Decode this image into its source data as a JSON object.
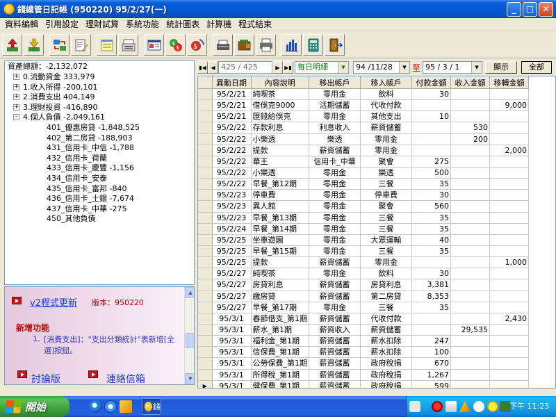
{
  "window": {
    "title": "錢總管日記帳 (950220) 95/2/27(一)",
    "controls": {
      "minimize": "_",
      "maximize": "□",
      "close": "✕"
    }
  },
  "menu": [
    "資料編輯",
    "引用設定",
    "理財試算",
    "系統功能",
    "統計圖表",
    "計算機",
    "程式結束"
  ],
  "toolbar_icons": [
    "import-up-icon",
    "export-down-icon",
    "transfer-icon",
    "edit-note-icon",
    "notepad-icon",
    "register-icon",
    "card-icon",
    "currency-exchange-icon",
    "currency-convert-icon",
    "scanner-icon",
    "wallet-icon",
    "print-icon",
    "bar-chart-icon",
    "calculator-icon",
    "exit-door-icon"
  ],
  "tree": {
    "root": "資產總額：-2,132,072",
    "nodes": [
      {
        "label": "0.流動資金 333,979",
        "expander": "+"
      },
      {
        "label": "1.收入所得 -200,101",
        "expander": "+"
      },
      {
        "label": "2.消費支出 404,149",
        "expander": "+"
      },
      {
        "label": "3.理財投資 -416,890",
        "expander": "+"
      },
      {
        "label": "4.個人負債 -2,049,161",
        "expander": "-"
      }
    ],
    "children": [
      "401_優惠房貸 -1,848,525",
      "402_第二房貸 -188,903",
      "431_信用卡_中信 -1,788",
      "432_信用卡_荷蘭",
      "433_信用卡_慶豐 -1,156",
      "434_信用卡_安泰",
      "435_信用卡_富邦 -840",
      "436_信用卡_土銀 -7,674",
      "437_信用卡_中華 -275",
      "450_其他負債"
    ]
  },
  "news": {
    "update_link": "v2程式更新",
    "version_label": "版本：950220",
    "features_title": "新增功能",
    "item_number": "1.",
    "item_text": "[消費支出]：\"支出分類統計\"表新增[全選]按鈕。",
    "forum_link": "討論版",
    "contact_link": "連絡信箱"
  },
  "nav": {
    "record_position": "425 / 425",
    "view_mode": "每日明細",
    "date_from": "94 /11/28",
    "to_label": "至",
    "date_to": "95 / 3 / 1",
    "show_button": "顯示",
    "all_button": "全部"
  },
  "grid": {
    "columns": [
      "異動日期",
      "內容說明",
      "移出帳戶",
      "移入帳戶",
      "付款金額",
      "收入金額",
      "移轉金額"
    ],
    "current_row_marker": "▶",
    "rows": [
      [
        "95/2/21",
        "純喫茶",
        "零用金",
        "飲料",
        "30",
        "",
        ""
      ],
      [
        "95/2/21",
        "借俁克9000",
        "活期儲蓄",
        "代收付款",
        "",
        "",
        "9,000"
      ],
      [
        "95/2/21",
        "匯錢給俁克",
        "零用金",
        "其他支出",
        "10",
        "",
        ""
      ],
      [
        "95/2/22",
        "存款利息",
        "利息收入",
        "薪資儲蓄",
        "",
        "530",
        ""
      ],
      [
        "95/2/22",
        "小樂透",
        "樂透",
        "零用金",
        "",
        "200",
        ""
      ],
      [
        "95/2/22",
        "提款",
        "薪資儲蓄",
        "零用金",
        "",
        "",
        "2,000"
      ],
      [
        "95/2/22",
        "華王",
        "信用卡_中華",
        "聚會",
        "275",
        "",
        ""
      ],
      [
        "95/2/22",
        "小樂透",
        "零用金",
        "樂透",
        "500",
        "",
        ""
      ],
      [
        "95/2/22",
        "早餐_第12期",
        "零用金",
        "三餐",
        "35",
        "",
        ""
      ],
      [
        "95/2/23",
        "停車費",
        "零用金",
        "停車費",
        "30",
        "",
        ""
      ],
      [
        "95/2/23",
        "異人館",
        "零用金",
        "聚會",
        "560",
        "",
        ""
      ],
      [
        "95/2/23",
        "早餐_第13期",
        "零用金",
        "三餐",
        "35",
        "",
        ""
      ],
      [
        "95/2/24",
        "早餐_第14期",
        "零用金",
        "三餐",
        "35",
        "",
        ""
      ],
      [
        "95/2/25",
        "坐車遊園",
        "零用金",
        "大眾運輸",
        "40",
        "",
        ""
      ],
      [
        "95/2/25",
        "早餐_第15期",
        "零用金",
        "三餐",
        "35",
        "",
        ""
      ],
      [
        "95/2/25",
        "提款",
        "薪資儲蓄",
        "零用金",
        "",
        "",
        "1,000"
      ],
      [
        "95/2/27",
        "純喫茶",
        "零用金",
        "飲料",
        "30",
        "",
        ""
      ],
      [
        "95/2/27",
        "房貸利息",
        "薪資儲蓄",
        "房貸利息",
        "3,381",
        "",
        ""
      ],
      [
        "95/2/27",
        "繳房貸",
        "薪資儲蓄",
        "第二房貸",
        "8,353",
        "",
        ""
      ],
      [
        "95/2/27",
        "早餐_第17期",
        "零用金",
        "三餐",
        "35",
        "",
        ""
      ],
      [
        "95/3/1",
        "春節借支_第1期",
        "薪資儲蓄",
        "代收付款",
        "",
        "",
        "2,430"
      ],
      [
        "95/3/1",
        "薪水_第1期",
        "薪資收入",
        "薪資儲蓄",
        "",
        "29,535",
        ""
      ],
      [
        "95/3/1",
        "福利金_第1期",
        "薪資儲蓄",
        "薪水扣除",
        "247",
        "",
        ""
      ],
      [
        "95/3/1",
        "信保費_第1期",
        "薪資儲蓄",
        "薪水扣除",
        "100",
        "",
        ""
      ],
      [
        "95/3/1",
        "公勞保費_第1期",
        "薪資儲蓄",
        "政府稅捐",
        "670",
        "",
        ""
      ],
      [
        "95/3/1",
        "所得稅_第1期",
        "薪資儲蓄",
        "政府稅捐",
        "1,267",
        "",
        ""
      ],
      [
        "95/3/1",
        "健保費_第1期",
        "薪資儲蓄",
        "政府稅捐",
        "599",
        "",
        ""
      ]
    ]
  },
  "taskbar": {
    "start_label": "開始",
    "task_label": "錢",
    "clock": "下午 11:23"
  }
}
